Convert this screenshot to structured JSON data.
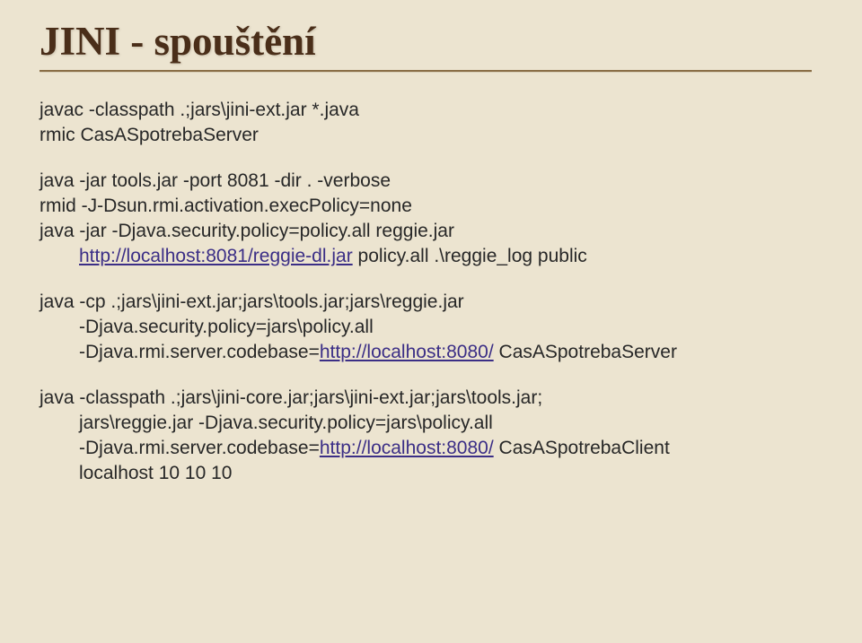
{
  "title": "JINI - spouštění",
  "p1": {
    "l1": "javac -classpath .;jars\\jini-ext.jar *.java",
    "l2": "rmic CasASpotrebaServer"
  },
  "p2": {
    "l1": "java -jar tools.jar -port 8081 -dir . -verbose",
    "l2": "rmid -J-Dsun.rmi.activation.execPolicy=none",
    "l3": "java -jar -Djava.security.policy=policy.all reggie.jar",
    "l3_link": "http://localhost:8081/reggie-dl.jar",
    "l3_suffix": " policy.all .\\reggie_log public"
  },
  "p3": {
    "l1": "java -cp .;jars\\jini-ext.jar;jars\\tools.jar;jars\\reggie.jar",
    "l2": "-Djava.security.policy=jars\\policy.all",
    "l3_pre": "-Djava.rmi.server.codebase=",
    "l3_link": "http://localhost:8080/",
    "l3_suf": " CasASpotrebaServer"
  },
  "p4": {
    "l1": "java -classpath .;jars\\jini-core.jar;jars\\jini-ext.jar;jars\\tools.jar;",
    "l2": "jars\\reggie.jar -Djava.security.policy=jars\\policy.all",
    "l3_pre": "-Djava.rmi.server.codebase=",
    "l3_link": "http://localhost:8080/",
    "l3_suf": " CasASpotrebaClient",
    "l4": "localhost 10 10 10"
  }
}
